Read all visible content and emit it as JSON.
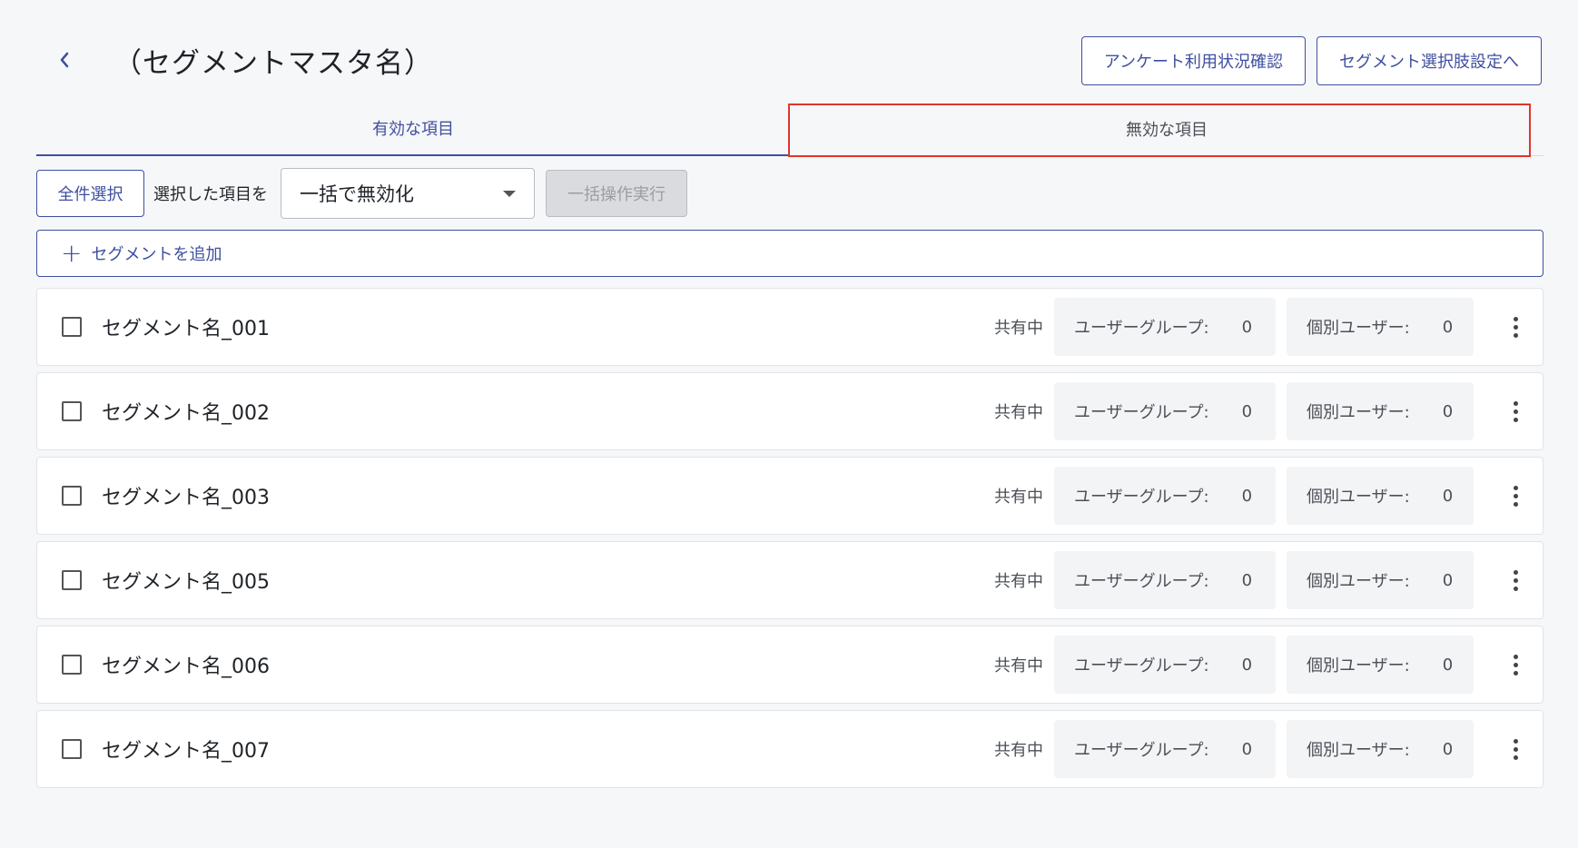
{
  "header": {
    "title": "（セグメントマスタ名）",
    "back_icon": "chevron-left-icon",
    "actions": [
      {
        "label": "アンケート利用状況確認"
      },
      {
        "label": "セグメント選択肢設定へ"
      }
    ]
  },
  "tabs": [
    {
      "label": "有効な項目",
      "active": true
    },
    {
      "label": "無効な項目",
      "active": false
    }
  ],
  "toolbar": {
    "select_all_label": "全件選択",
    "selected_items_label": "選択した項目を",
    "bulk_action_value": "一括で無効化",
    "execute_label": "一括操作実行"
  },
  "add_segment": {
    "label": "セグメントを追加",
    "icon": "plus-icon"
  },
  "rows": [
    {
      "name": "セグメント名_001",
      "status": "共有中",
      "group_label": "ユーザーグループ:",
      "group_count": "0",
      "user_label": "個別ユーザー:",
      "user_count": "0"
    },
    {
      "name": "セグメント名_002",
      "status": "共有中",
      "group_label": "ユーザーグループ:",
      "group_count": "0",
      "user_label": "個別ユーザー:",
      "user_count": "0"
    },
    {
      "name": "セグメント名_003",
      "status": "共有中",
      "group_label": "ユーザーグループ:",
      "group_count": "0",
      "user_label": "個別ユーザー:",
      "user_count": "0"
    },
    {
      "name": "セグメント名_005",
      "status": "共有中",
      "group_label": "ユーザーグループ:",
      "group_count": "0",
      "user_label": "個別ユーザー:",
      "user_count": "0"
    },
    {
      "name": "セグメント名_006",
      "status": "共有中",
      "group_label": "ユーザーグループ:",
      "group_count": "0",
      "user_label": "個別ユーザー:",
      "user_count": "0"
    },
    {
      "name": "セグメント名_007",
      "status": "共有中",
      "group_label": "ユーザーグループ:",
      "group_count": "0",
      "user_label": "個別ユーザー:",
      "user_count": "0"
    }
  ],
  "colors": {
    "accent": "#3f4fa0",
    "highlight": "#e0362c",
    "background": "#f6f7f9"
  }
}
